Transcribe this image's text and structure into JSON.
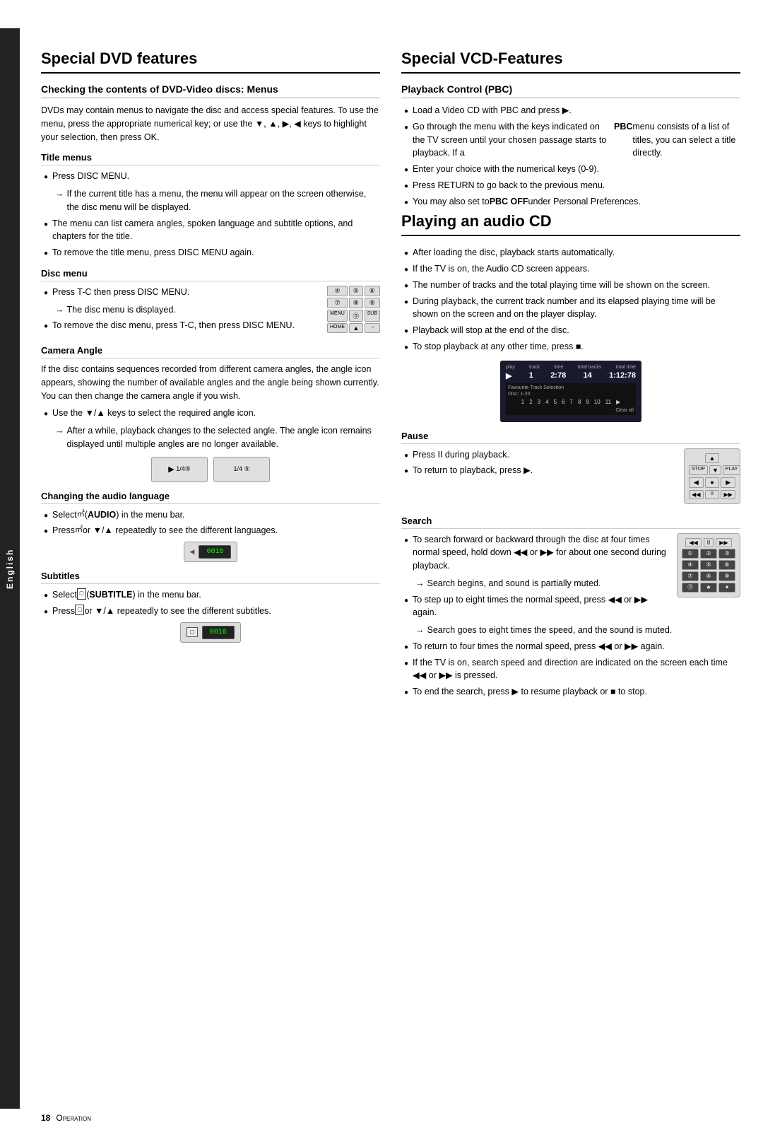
{
  "sidebar": {
    "label": "English"
  },
  "left": {
    "mainTitle": "Special DVD features",
    "checking": {
      "title": "Checking the contents of DVD-Video discs: Menus",
      "body": "DVDs may contain menus to navigate the disc and access special features. To use the menu, press the appropriate numerical key; or use the ▼, ▲, ▶, ◀ keys to highlight your selection, then press OK."
    },
    "titleMenus": {
      "title": "Title menus",
      "items": [
        "Press DISC MENU.",
        "If the current title has a menu, the menu will appear on the screen otherwise, the disc menu will be displayed.",
        "The menu can list camera angles, spoken language and subtitle options, and chapters for the title.",
        "To remove the title menu, press DISC MENU again."
      ],
      "arrow1": "If the current title has a menu, the menu will appear on the screen otherwise, the disc menu will be displayed."
    },
    "discMenu": {
      "title": "Disc menu",
      "items": [
        "Press T-C then press DISC MENU.",
        "To remove the disc menu, press T-C, then press DISC MENU."
      ],
      "arrow1": "The disc menu is displayed."
    },
    "cameraAngle": {
      "title": "Camera Angle",
      "body": "If the disc contains sequences recorded from different camera angles, the angle icon appears, showing the number of available angles and the angle being shown currently. You can then change the camera angle if you wish.",
      "items": [
        "Use the ▼/▲ keys to select the required angle icon.",
        "After a while, playback changes to the selected angle. The angle icon remains displayed until multiple angles are no longer available."
      ],
      "arrow1": "After a while, playback changes to the selected angle. The angle icon remains displayed until multiple angles are no longer available."
    },
    "audioLanguage": {
      "title": "Changing the audio language",
      "items": [
        "Select (AUDIO) in the menu bar.",
        "Press or ▼/▲ repeatedly to see the different languages."
      ]
    },
    "subtitles": {
      "title": "Subtitles",
      "items": [
        "Select (SUBTITLE) in the menu bar.",
        "Press or ▼/▲ repeatedly to see the different subtitles."
      ]
    }
  },
  "right": {
    "vcdTitle": "Special VCD-Features",
    "pbc": {
      "title": "Playback Control (PBC)",
      "items": [
        "Load a Video CD with PBC and press ▶.",
        "Go through the menu with the keys indicated on the TV screen until your chosen passage starts to playback. If a PBC menu consists of a list of titles, you can select a title directly.",
        "Enter your choice with the numerical keys (0-9).",
        "Press RETURN to go back to the previous menu.",
        "You may also set to PBC OFF under Personal Preferences."
      ]
    },
    "audioCD": {
      "title": "Playing an audio CD",
      "items": [
        "After loading the disc, playback starts automatically.",
        "If the TV is on, the Audio CD screen appears.",
        "The number of tracks and the total playing time will be shown on the screen.",
        "During playback, the current track number and its elapsed playing time will be shown on the screen and on the player display.",
        "Playback will stop at the end of the disc.",
        "To stop playback at any other time, press ■."
      ],
      "lcd": {
        "playLabel": "play",
        "trackLabel": "track",
        "timeLabel": "time",
        "totalTracksLabel": "total tracks",
        "totalTimeLabel": "total time",
        "playValue": "▶",
        "trackValue": "1",
        "timeValue": "2:78",
        "totalTracksValue": "14",
        "totalTimeValue": "1:12:78",
        "favLabel": "Favourite Track Selection",
        "discLabel": "Disc: 1-20",
        "tracks": [
          "1",
          "2",
          "3",
          "4",
          "5",
          "6",
          "7",
          "8",
          "9",
          "10",
          "11",
          "▶"
        ],
        "clearLabel": "Clear all"
      }
    },
    "pause": {
      "title": "Pause",
      "items": [
        "Press II during playback.",
        "To return to playback, press ▶."
      ]
    },
    "search": {
      "title": "Search",
      "items": [
        "To search forward or backward through the disc at four times normal speed, hold down ◀◀ or ▶▶ for about one second during playback.",
        "To step up to eight times the normal speed, press ◀◀ or ▶▶ again.",
        "To return to four times the normal speed, press ◀◀ or ▶▶ again.",
        "If the TV is on, search speed and direction are indicated on the screen each time ◀◀ or ▶▶ is pressed.",
        "To end the search, press ▶ to resume playback or ■ to stop."
      ],
      "arrow1": "Search begins, and sound is partially muted.",
      "arrow2": "Search goes to eight times the speed, and the sound is muted."
    }
  },
  "footer": {
    "pageNum": "18",
    "label": "Operation"
  }
}
